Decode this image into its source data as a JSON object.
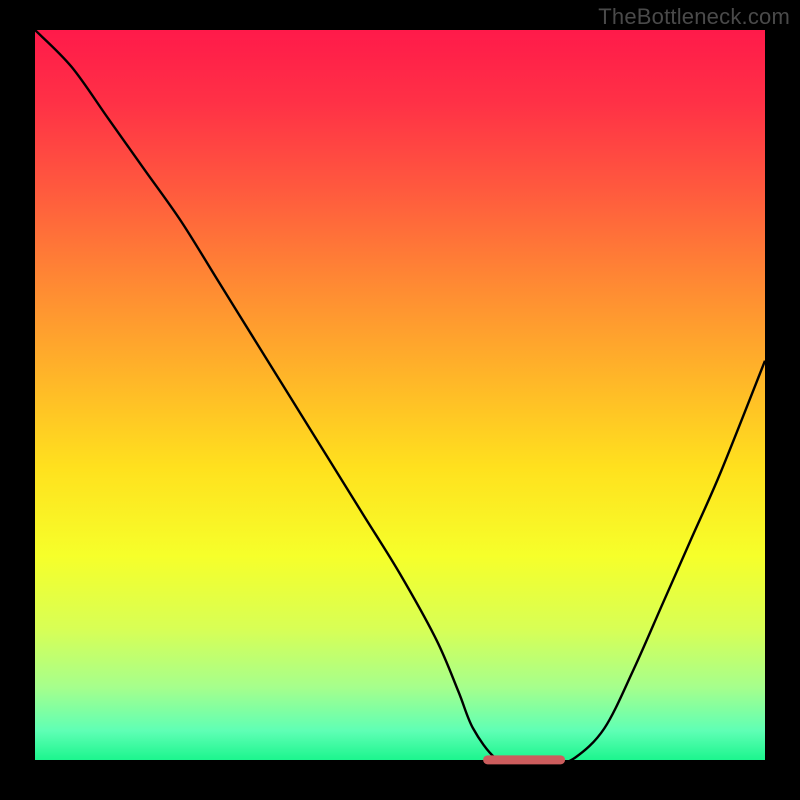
{
  "watermark": "TheBottleneck.com",
  "chart_data": {
    "type": "line",
    "title": "",
    "xlabel": "",
    "ylabel": "",
    "xlim": [
      0,
      100
    ],
    "ylim": [
      0,
      100
    ],
    "legend": false,
    "grid": false,
    "series": [
      {
        "name": "bottleneck-curve",
        "x": [
          0,
          5,
          10,
          15,
          20,
          25,
          30,
          35,
          40,
          45,
          50,
          55,
          58,
          60,
          63,
          66,
          68,
          71,
          74,
          78,
          82,
          86,
          90,
          94,
          100
        ],
        "values": [
          100,
          95,
          88,
          81,
          74,
          66,
          58,
          50,
          42,
          34,
          26,
          17,
          10,
          5,
          1,
          0,
          0,
          0,
          1,
          5,
          13,
          22,
          31,
          40,
          55
        ]
      },
      {
        "name": "bottleneck-floor-marker",
        "x": [
          62,
          72
        ],
        "values": [
          0.7,
          0.7
        ]
      }
    ],
    "gradient_stops": [
      {
        "offset": 0.0,
        "color": "#ff1a4a"
      },
      {
        "offset": 0.1,
        "color": "#ff3146"
      },
      {
        "offset": 0.22,
        "color": "#ff5a3e"
      },
      {
        "offset": 0.35,
        "color": "#ff8a33"
      },
      {
        "offset": 0.48,
        "color": "#ffb728"
      },
      {
        "offset": 0.6,
        "color": "#ffe11e"
      },
      {
        "offset": 0.72,
        "color": "#f6ff2a"
      },
      {
        "offset": 0.82,
        "color": "#d8ff55"
      },
      {
        "offset": 0.9,
        "color": "#a6ff8c"
      },
      {
        "offset": 0.96,
        "color": "#5fffb5"
      },
      {
        "offset": 1.0,
        "color": "#1cf58e"
      }
    ],
    "marker_color": "#cc5d5d"
  }
}
